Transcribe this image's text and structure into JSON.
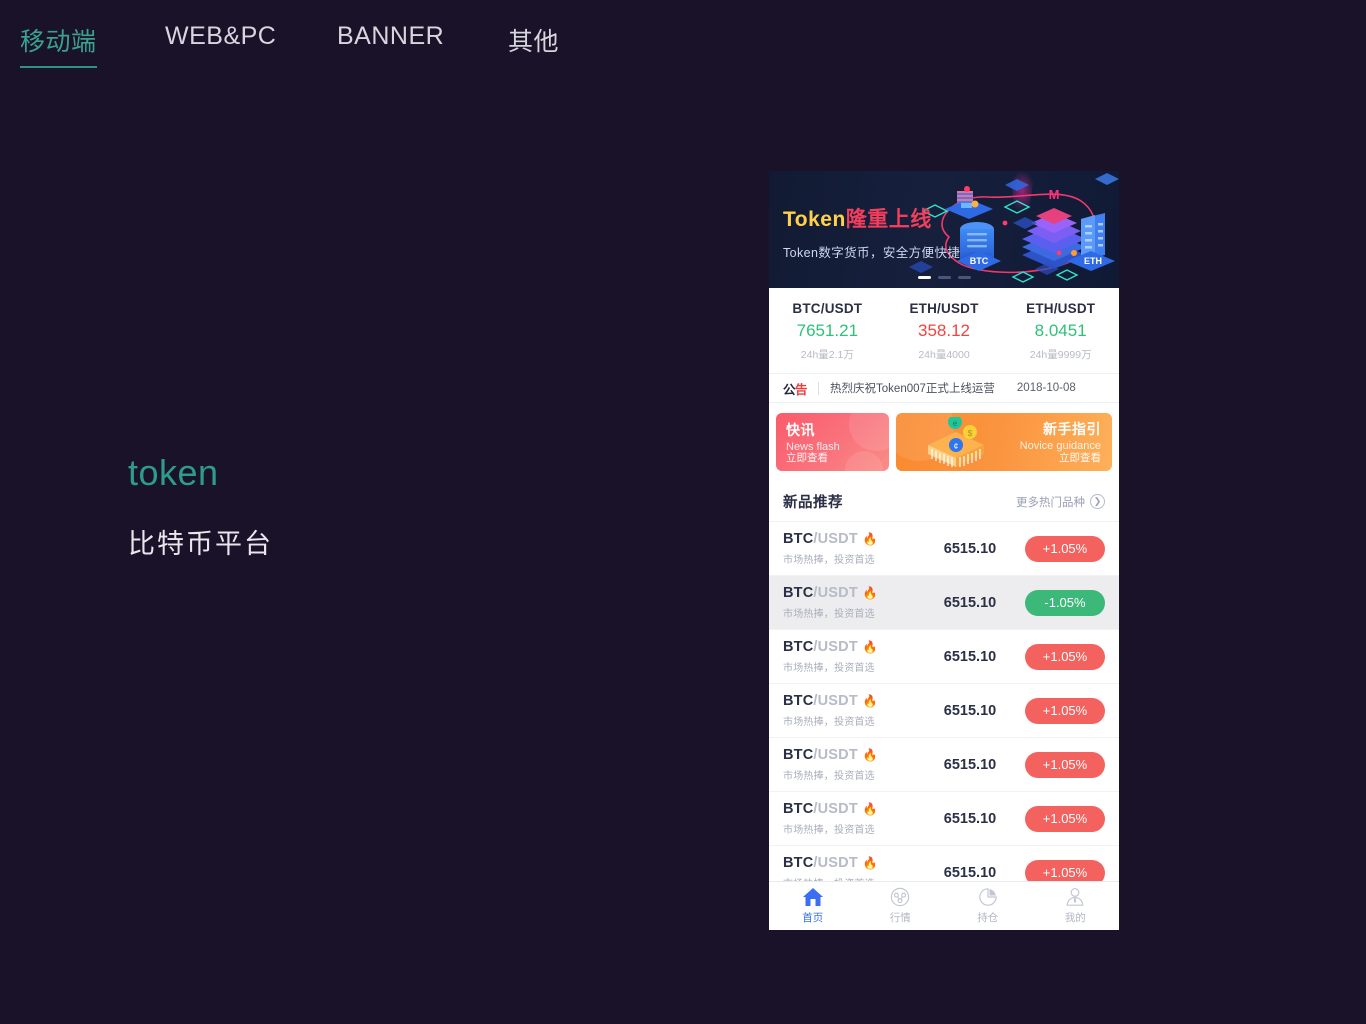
{
  "topnav": {
    "tabs": [
      {
        "label": "移动端",
        "active": true
      },
      {
        "label": "WEB&PC",
        "active": false
      },
      {
        "label": "BANNER",
        "active": false
      },
      {
        "label": "其他",
        "active": false
      }
    ],
    "active_color": "#3aa18f",
    "inactive_color": "#d7d5de"
  },
  "hero": {
    "title": "token",
    "subtitle": "比特币平台",
    "title_color": "#2e9c88"
  },
  "phone": {
    "banner": {
      "title_token": "Token",
      "title_cn": "隆重上线",
      "subtitle": "Token数字货币，安全方便快捷",
      "labels": {
        "btc": "BTC",
        "eth": "ETH",
        "m": "M"
      },
      "dots": 3,
      "active_dot": 0,
      "token_color": "#ffd24a",
      "cn_color": "#f23e5d"
    },
    "tickers": [
      {
        "pair": "BTC/USDT",
        "price": "7651.21",
        "dir": "up",
        "volume": "24h量2.1万"
      },
      {
        "pair": "ETH/USDT",
        "price": "358.12",
        "dir": "down",
        "volume": "24h量4000"
      },
      {
        "pair": "ETH/USDT",
        "price": "8.0451",
        "dir": "up",
        "volume": "24h量9999万"
      }
    ],
    "notice": {
      "tag_part1": "公",
      "tag_part2": "告",
      "text": "热烈庆祝Token007正式上线运营",
      "date": "2018-10-08"
    },
    "promos": [
      {
        "title": "快讯",
        "en": "News flash",
        "cta": "立即查看",
        "color": "#fb5b6b"
      },
      {
        "title": "新手指引",
        "en": "Novice guidance",
        "cta": "立即查看",
        "color": "#f98a2e"
      }
    ],
    "section": {
      "title": "新品推荐",
      "more_label": "更多热门品种",
      "more_icon": "chevron-right-circle-icon"
    },
    "rows": [
      {
        "symbol": "BTC",
        "quote": "/USDT",
        "hot": true,
        "desc": "市场热捧，投资首选",
        "price": "6515.10",
        "change": "+1.05%",
        "dir": "up",
        "alt": false
      },
      {
        "symbol": "BTC",
        "quote": "/USDT",
        "hot": true,
        "desc": "市场热捧，投资首选",
        "price": "6515.10",
        "change": "-1.05%",
        "dir": "down",
        "alt": true
      },
      {
        "symbol": "BTC",
        "quote": "/USDT",
        "hot": true,
        "desc": "市场热捧，投资首选",
        "price": "6515.10",
        "change": "+1.05%",
        "dir": "up",
        "alt": false
      },
      {
        "symbol": "BTC",
        "quote": "/USDT",
        "hot": true,
        "desc": "市场热捧，投资首选",
        "price": "6515.10",
        "change": "+1.05%",
        "dir": "up",
        "alt": false
      },
      {
        "symbol": "BTC",
        "quote": "/USDT",
        "hot": true,
        "desc": "市场热捧，投资首选",
        "price": "6515.10",
        "change": "+1.05%",
        "dir": "up",
        "alt": false
      },
      {
        "symbol": "BTC",
        "quote": "/USDT",
        "hot": true,
        "desc": "市场热捧，投资首选",
        "price": "6515.10",
        "change": "+1.05%",
        "dir": "up",
        "alt": false
      },
      {
        "symbol": "BTC",
        "quote": "/USDT",
        "hot": true,
        "desc": "市场热捧，投资首选",
        "price": "6515.10",
        "change": "+1.05%",
        "dir": "up",
        "alt": false
      }
    ],
    "tabbar": [
      {
        "label": "首页",
        "icon": "home-icon",
        "active": true
      },
      {
        "label": "行情",
        "icon": "market-chart-icon",
        "active": false
      },
      {
        "label": "持仓",
        "icon": "pie-chart-icon",
        "active": false
      },
      {
        "label": "我的",
        "icon": "user-icon",
        "active": false
      }
    ],
    "tabbar_active_color": "#3b6ef0"
  }
}
